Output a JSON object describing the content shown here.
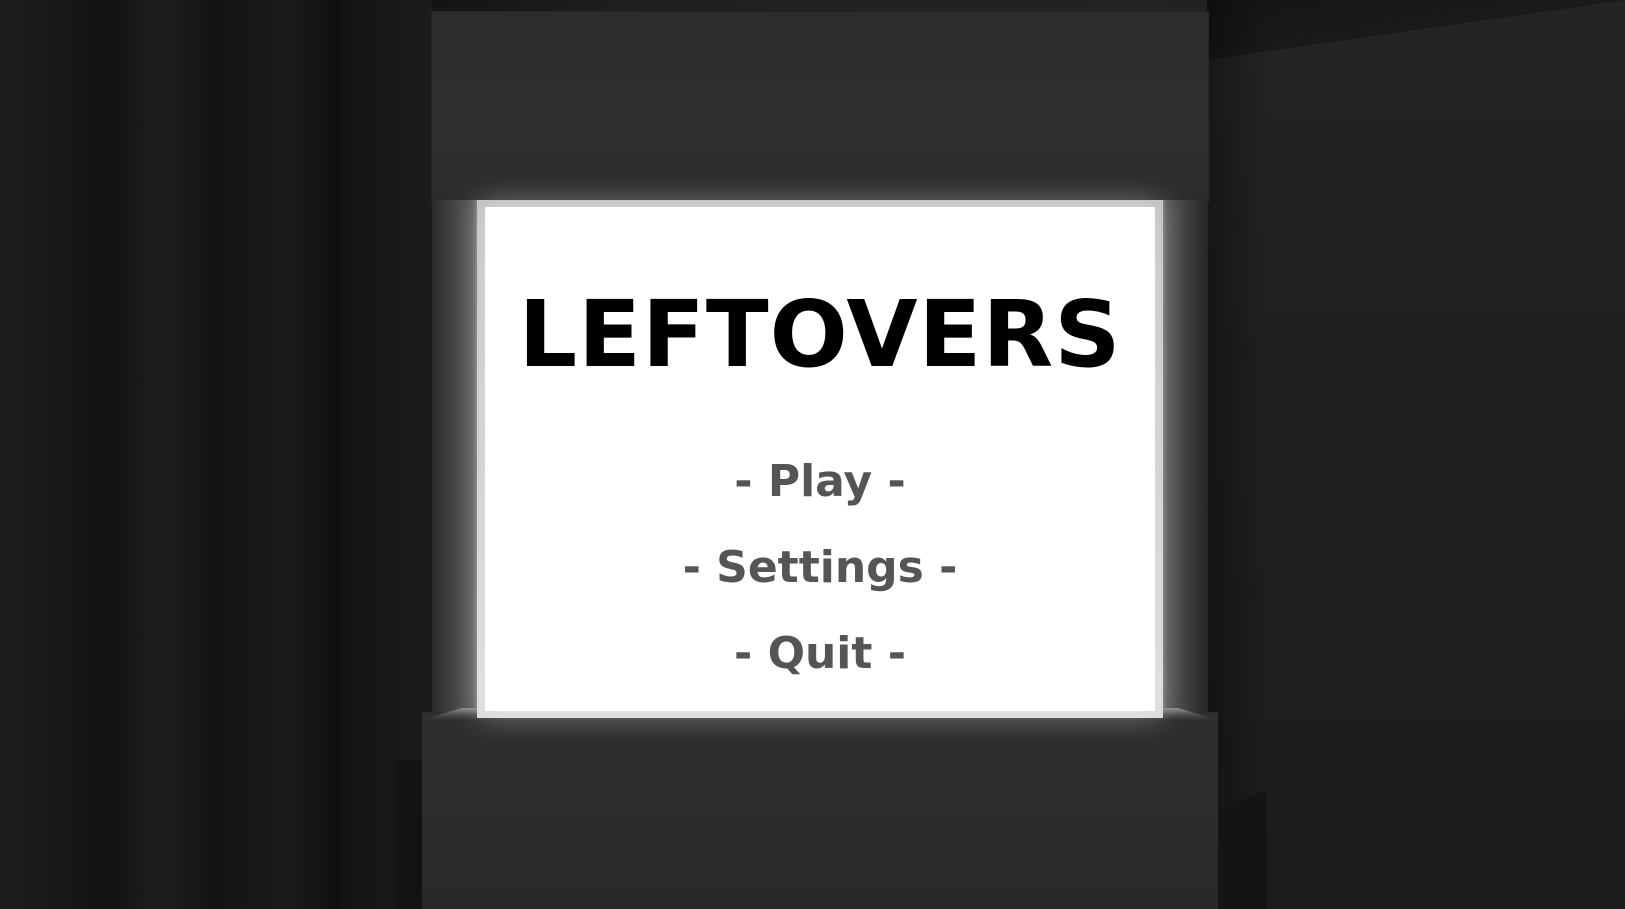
{
  "game": {
    "title": "LEFTOVERS"
  },
  "menu": {
    "items": [
      {
        "label": "- Play -"
      },
      {
        "label": "- Settings -"
      },
      {
        "label": "- Quit -"
      }
    ]
  },
  "colors": {
    "screen_background": "#ffffff",
    "title_text": "#000000",
    "menu_text": "#555555",
    "room_background": "#1a1a1a"
  }
}
